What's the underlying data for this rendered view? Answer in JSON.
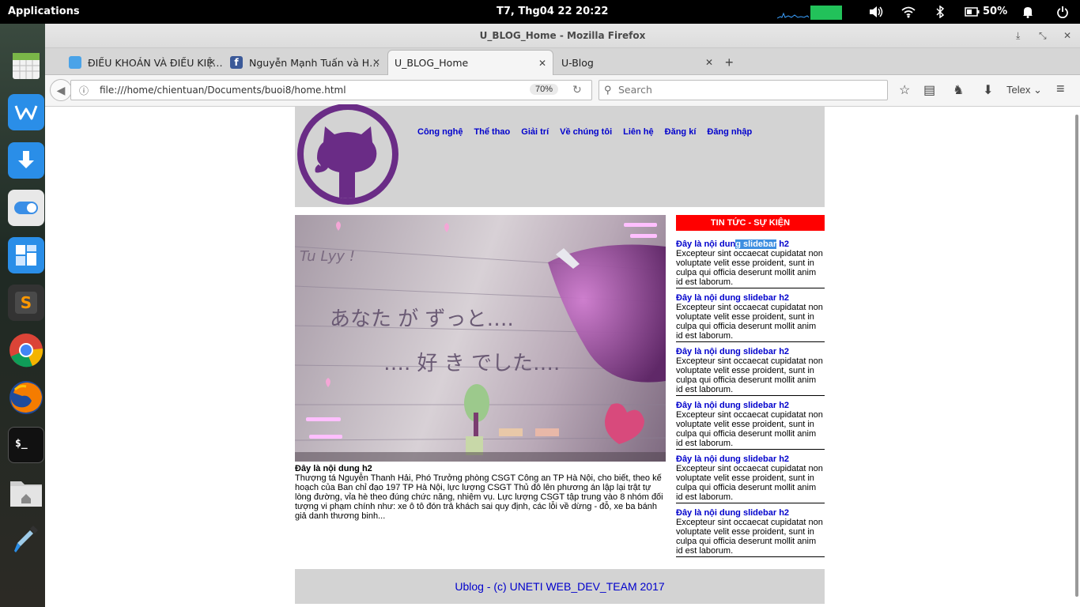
{
  "system": {
    "apps_label": "Applications",
    "clock": "T7, Thg04 22   20:22",
    "battery": "50%"
  },
  "window": {
    "title": "U_BLOG_Home - Mozilla Firefox"
  },
  "tabs": [
    {
      "label": "ĐIỀU KHOẢN VÀ ĐIỀU KIỆ…",
      "icon": "peace-icon"
    },
    {
      "label": "Nguyễn Mạnh Tuấn và H…",
      "icon": "facebook-icon"
    },
    {
      "label": "U_BLOG_Home",
      "icon": ""
    },
    {
      "label": "U-Blog",
      "icon": ""
    }
  ],
  "navbar": {
    "url": "file:///home/chientuan/Documents/buoi8/home.html",
    "zoom": "70%",
    "search_placeholder": "Search",
    "ime": "Telex"
  },
  "page": {
    "nav": [
      "Công nghệ",
      "Thể thao",
      "Giải trí",
      "Về chúng tôi",
      "Liên hệ",
      "Đăng kí",
      "Đăng nhập"
    ],
    "main_title": "Đây là nội dung h2",
    "main_text": "Thượng tá Nguyễn Thanh Hải, Phó Trưởng phòng CSGT Công an TP Hà Nội, cho biết, theo kế hoạch của Ban chỉ đạo 197 TP Hà Nội, lực lượng CSGT Thủ đô lên phương án lập lại trật tự lòng đường, vỉa hè theo đúng chức năng, nhiệm vụ. Lực lượng CSGT tập trung vào 8 nhóm đối tượng vi phạm chính như: xe ô tô đón trả khách sai quy định, các lỗi về dừng - đỗ, xe ba bánh giả danh thương binh...",
    "sidebar_title": "TIN TỨC - SỰ KIỆN",
    "sidebar_items": [
      {
        "title_a": "Đây là nội dun",
        "title_hl": "g slidebar",
        "title_b": " h2",
        "text": "Excepteur sint occaecat cupidatat non voluptate velit esse proident, sunt in culpa qui officia deserunt mollit anim id est laborum."
      },
      {
        "title": "Đây là nội dung slidebar h2",
        "text": "Excepteur sint occaecat cupidatat non voluptate velit esse proident, sunt in culpa qui officia deserunt mollit anim id est laborum."
      },
      {
        "title": "Đây là nội dung slidebar h2",
        "text": "Excepteur sint occaecat cupidatat non voluptate velit esse proident, sunt in culpa qui officia deserunt mollit anim id est laborum."
      },
      {
        "title": "Đây là nội dung slidebar h2",
        "text": "Excepteur sint occaecat cupidatat non voluptate velit esse proident, sunt in culpa qui officia deserunt mollit anim id est laborum."
      },
      {
        "title": "Đây là nội dung slidebar h2",
        "text": "Excepteur sint occaecat cupidatat non voluptate velit esse proident, sunt in culpa qui officia deserunt mollit anim id est laborum."
      },
      {
        "title": "Đây là nội dung slidebar h2",
        "text": "Excepteur sint occaecat cupidatat non voluptate velit esse proident, sunt in culpa qui officia deserunt mollit anim id est laborum."
      }
    ],
    "footer": "Ublog - (c) UNETI WEB_DEV_TEAM 2017",
    "hero_text": {
      "line1": "Tu Lyy !",
      "line2": "あなた が ずっと….",
      "line3": "…. 好 き でした…."
    }
  },
  "colors": {
    "header_bg": "#d3d3d3",
    "nav_link": "#0000cc",
    "sidebar_title_bg": "#ff0000",
    "logo": "#6a2c86"
  },
  "dock": [
    {
      "name": "calendar-app-icon"
    },
    {
      "name": "wps-writer-icon"
    },
    {
      "name": "downloader-icon"
    },
    {
      "name": "settings-toggle-icon"
    },
    {
      "name": "workspace-icon"
    },
    {
      "name": "sublime-text-icon"
    },
    {
      "name": "chrome-icon"
    },
    {
      "name": "firefox-icon"
    },
    {
      "name": "terminal-icon"
    },
    {
      "name": "home-folder-icon"
    },
    {
      "name": "color-picker-icon"
    }
  ]
}
